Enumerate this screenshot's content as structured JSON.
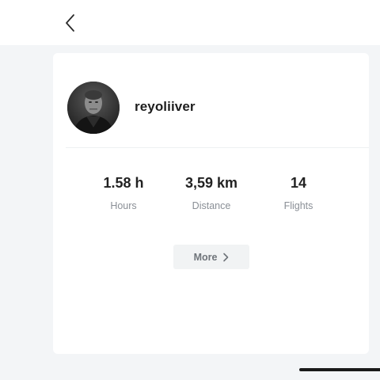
{
  "nav": {
    "back_icon": "chevron-left-icon"
  },
  "profile": {
    "username": "reyoliiver",
    "avatar": "avatar-photo"
  },
  "stats": [
    {
      "value": "1.58 h",
      "label": "Hours"
    },
    {
      "value": "3,59 km",
      "label": "Distance"
    },
    {
      "value": "14",
      "label": "Flights"
    }
  ],
  "more_button": {
    "label": "More",
    "icon": "chevron-right-icon"
  },
  "colors": {
    "background": "#f3f5f7",
    "card": "#ffffff",
    "text_primary": "#1e1e1e",
    "text_secondary": "#8a8f96",
    "button_bg": "#f1f3f4"
  }
}
